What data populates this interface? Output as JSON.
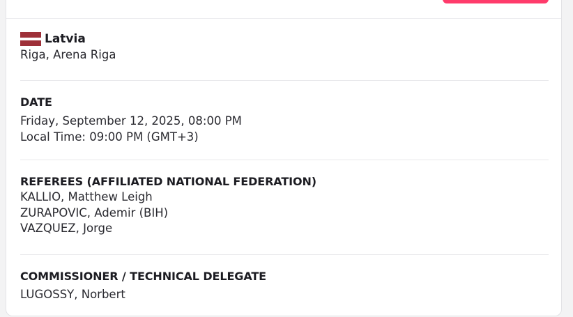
{
  "venue": {
    "country": "Latvia",
    "flag_colors": [
      "#9e3039",
      "#ffffff",
      "#9e3039"
    ],
    "location": "Riga, Arena Riga"
  },
  "date": {
    "heading": "DATE",
    "datetime": "Friday, September 12, 2025, 08:00 PM",
    "local_time": "Local Time: 09:00 PM (GMT+3)"
  },
  "referees": {
    "heading": "REFEREES (AFFILIATED NATIONAL FEDERATION)",
    "names": [
      "KALLIO, Matthew Leigh",
      "ZURAPOVIC, Ademir (BIH)",
      "VAZQUEZ, Jorge"
    ]
  },
  "commissioner": {
    "heading": "COMMISSIONER / TECHNICAL DELEGATE",
    "name": "LUGOSSY, Norbert"
  },
  "colors": {
    "accent_button": "#ff3b6b"
  }
}
